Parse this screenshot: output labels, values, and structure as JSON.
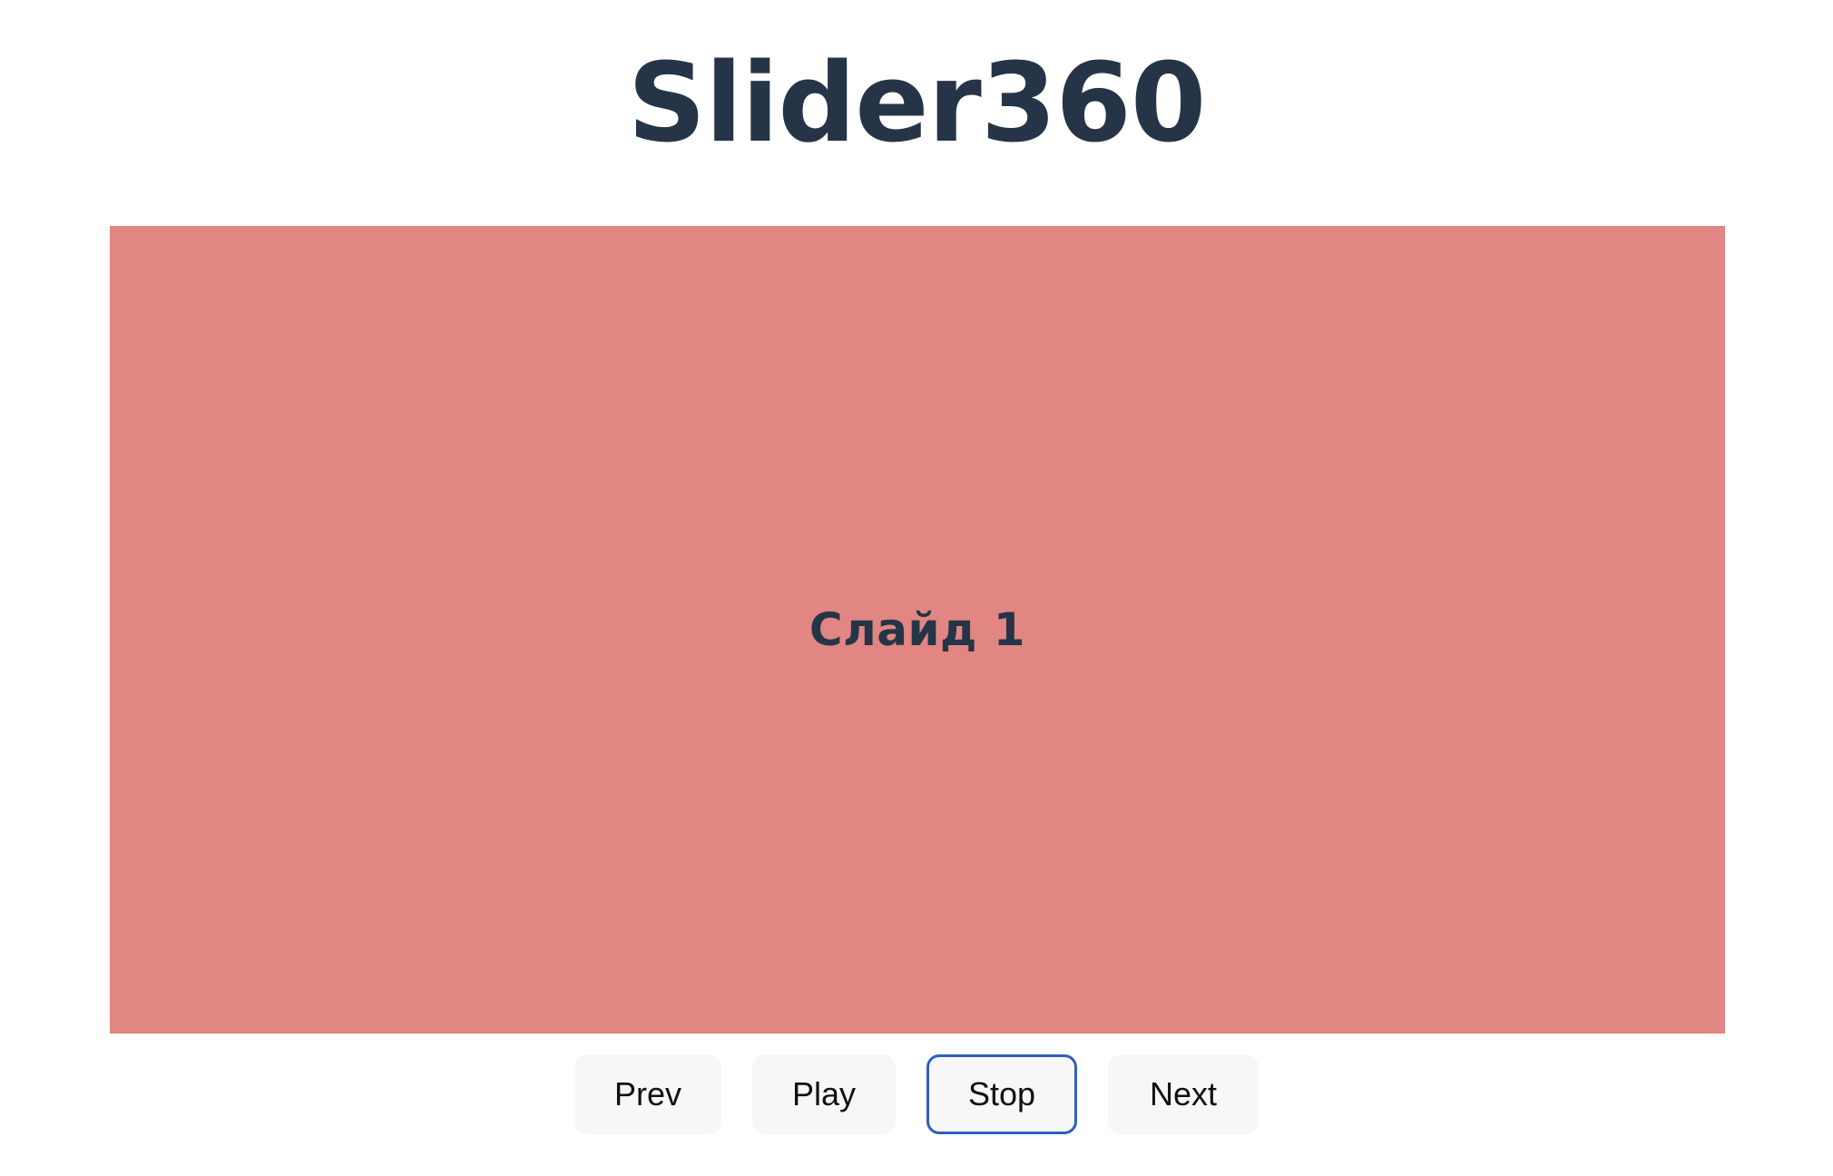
{
  "header": {
    "title": "Slider360"
  },
  "slider": {
    "current_slide": {
      "label": "Слайд 1",
      "background": "#e18683"
    }
  },
  "controls": {
    "prev_label": "Prev",
    "play_label": "Play",
    "stop_label": "Stop",
    "next_label": "Next",
    "focused": "stop",
    "focus_color": "#2f5fbf"
  },
  "colors": {
    "text": "#253547",
    "button_bg": "#f7f7f7"
  }
}
